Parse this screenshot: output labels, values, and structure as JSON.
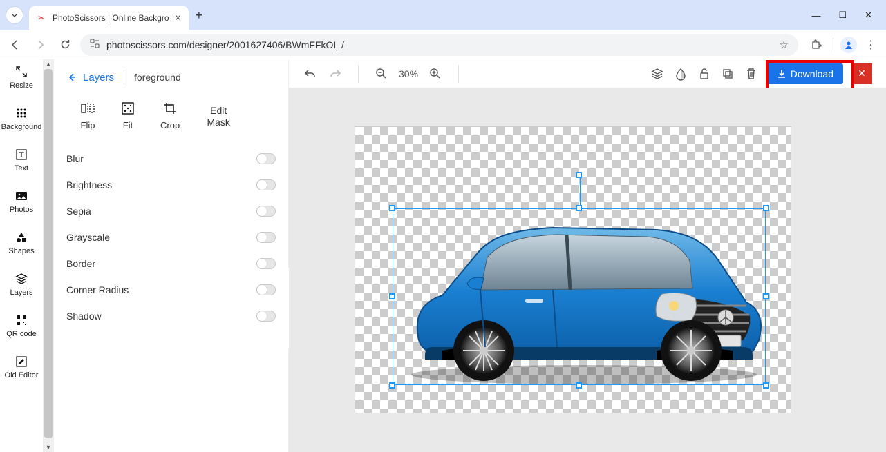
{
  "browser": {
    "tab_title": "PhotoScissors | Online Backgro",
    "url": "photoscissors.com/designer/2001627406/BWmFFkOI_/"
  },
  "sidebar": {
    "items": [
      {
        "label": "Resize"
      },
      {
        "label": "Background"
      },
      {
        "label": "Text"
      },
      {
        "label": "Photos"
      },
      {
        "label": "Shapes"
      },
      {
        "label": "Layers"
      },
      {
        "label": "QR code"
      },
      {
        "label": "Old Editor"
      }
    ]
  },
  "properties": {
    "back_label": "Layers",
    "layer_name": "foreground",
    "tools": {
      "flip": "Flip",
      "fit": "Fit",
      "crop": "Crop",
      "edit_mask": "Edit\nMask"
    },
    "adjustments": [
      {
        "label": "Blur"
      },
      {
        "label": "Brightness"
      },
      {
        "label": "Sepia"
      },
      {
        "label": "Grayscale"
      },
      {
        "label": "Border"
      },
      {
        "label": "Corner Radius"
      },
      {
        "label": "Shadow"
      }
    ]
  },
  "toolbar": {
    "zoom": "30%",
    "download_label": "Download"
  }
}
